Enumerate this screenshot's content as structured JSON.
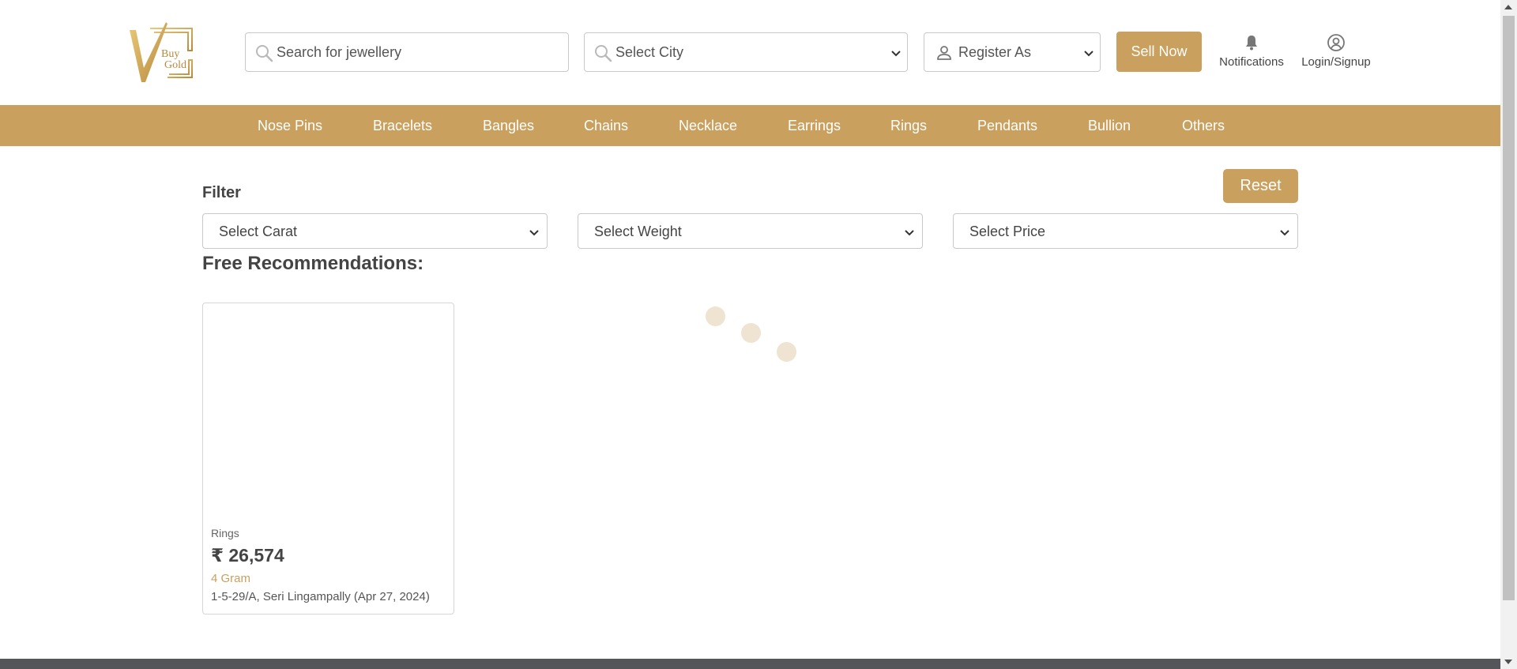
{
  "header": {
    "logo": {
      "text_line1": "Buy",
      "text_line2": "Gold",
      "icon": "v-check-logo"
    },
    "search": {
      "placeholder": "Search for jewellery",
      "icon": "search-icon"
    },
    "city": {
      "value": "Select City",
      "icon": "search-icon"
    },
    "register": {
      "value": "Register As",
      "icon": "user-icon"
    },
    "sell_label": "Sell Now",
    "notifications_label": "Notifications",
    "login_label": "Login/Signup"
  },
  "categories": [
    "Nose Pins",
    "Bracelets",
    "Bangles",
    "Chains",
    "Necklace",
    "Earrings",
    "Rings",
    "Pendants",
    "Bullion",
    "Others"
  ],
  "filter": {
    "label": "Filter",
    "reset_label": "Reset",
    "carat": "Select Carat",
    "weight": "Select Weight",
    "price": "Select Price"
  },
  "recommendations": {
    "title": "Free Recommendations:",
    "items": [
      {
        "category": "Rings",
        "price": "₹ 26,574",
        "weight": "4 Gram",
        "address": "1-5-29/A, Seri Lingampally (Apr 27, 2024)"
      }
    ]
  },
  "colors": {
    "accent": "#c9a05e",
    "loader_dot": "#efe3d2",
    "footer": "#54565a"
  }
}
